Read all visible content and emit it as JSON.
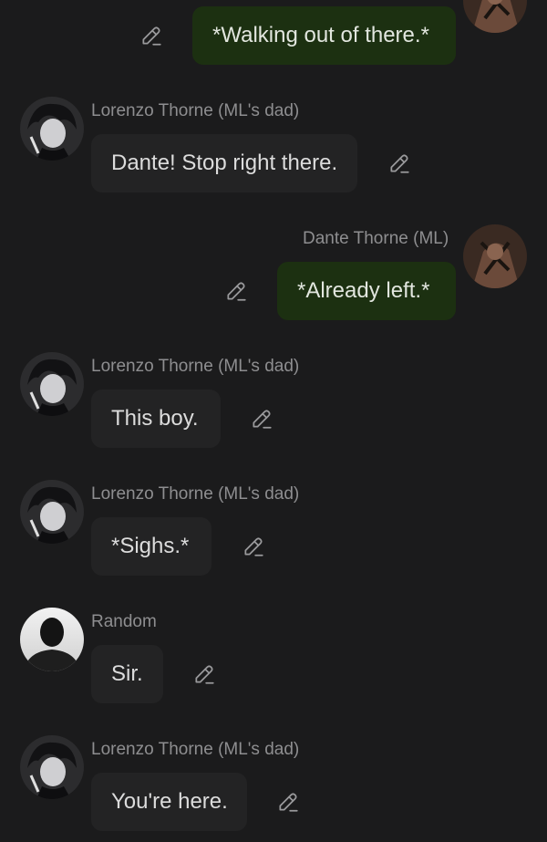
{
  "messages": [
    {
      "sender": "",
      "text": "*Walking out of there.*",
      "mine": true,
      "avatar": "character-avatar"
    },
    {
      "sender": "Lorenzo Thorne (ML's dad)",
      "text": "Dante! Stop right there.",
      "mine": false,
      "avatar": "character-avatar"
    },
    {
      "sender": "Dante Thorne (ML)",
      "text": "*Already left.*",
      "mine": true,
      "avatar": "character-avatar"
    },
    {
      "sender": "Lorenzo Thorne (ML's dad)",
      "text": "This boy.",
      "mine": false,
      "avatar": "character-avatar"
    },
    {
      "sender": "Lorenzo Thorne (ML's dad)",
      "text": "*Sighs.*",
      "mine": false,
      "avatar": "character-avatar"
    },
    {
      "sender": "Random",
      "text": "Sir.",
      "mine": false,
      "avatar": "silhouette-avatar"
    },
    {
      "sender": "Lorenzo Thorne (ML's dad)",
      "text": "You're here.",
      "mine": false,
      "avatar": "character-avatar"
    }
  ],
  "icons": {
    "edit": "pencil-icon"
  },
  "colors": {
    "background": "#1b1b1c",
    "bubble": "#232324",
    "bubble_mine": "#1c3011",
    "sender_name": "#8e8e90",
    "message_text": "#dcdcdc"
  }
}
